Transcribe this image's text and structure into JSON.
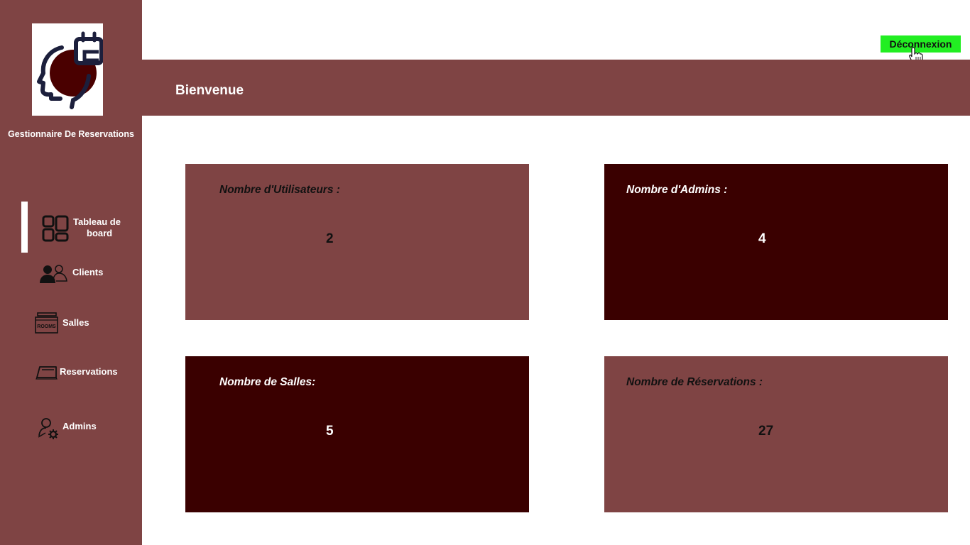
{
  "app": {
    "name": "Gestionnaire De Reservations",
    "logo_icon": "head-calendar-logo"
  },
  "header": {
    "title": "Bienvenue",
    "logout_label": "Déconnexion"
  },
  "sidebar": {
    "items": [
      {
        "label_line1": "Tableau de",
        "label_line2": "board",
        "icon": "dashboard-icon",
        "active": true
      },
      {
        "label": "Clients",
        "icon": "users-icon"
      },
      {
        "label": "Salles",
        "icon": "rooms-icon"
      },
      {
        "label": "Reservations",
        "icon": "ticket-icon"
      },
      {
        "label": "Admins",
        "icon": "admin-gear-icon"
      }
    ]
  },
  "cards": [
    {
      "title": "Nombre d'Utilisateurs :",
      "value": "2"
    },
    {
      "title": "Nombre d'Admins :",
      "value": "4"
    },
    {
      "title": "Nombre de Salles:",
      "value": "5"
    },
    {
      "title": "Nombre de Réservations :",
      "value": "27"
    }
  ],
  "colors": {
    "sidebar": "#7f4444",
    "dark_card": "#3a0000",
    "logout_bg": "#22ee22"
  }
}
